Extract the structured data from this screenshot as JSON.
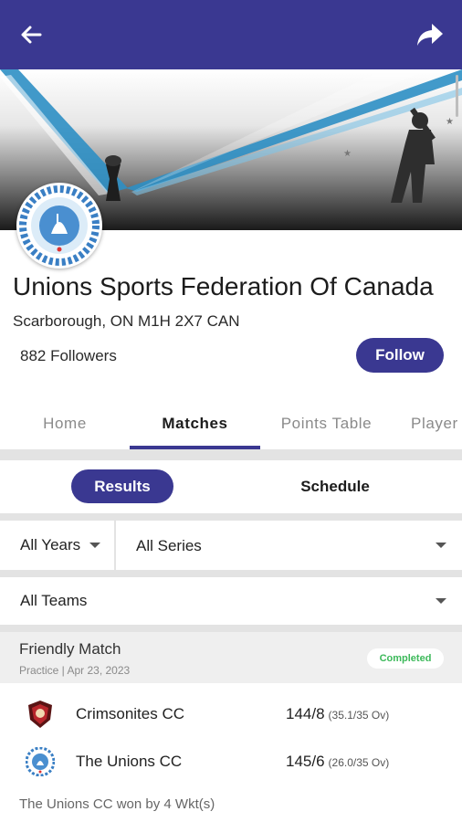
{
  "header": {
    "back_icon": "arrow-left-icon",
    "share_icon": "share-icon",
    "bar_color": "#3a3891"
  },
  "profile": {
    "name": "Unions Sports Federation Of Canada",
    "address": "Scarborough, ON M1H 2X7 CAN",
    "followers": "882 Followers",
    "follow_label": "Follow"
  },
  "tabs": [
    {
      "label": "Home",
      "active": false
    },
    {
      "label": "Matches",
      "active": true
    },
    {
      "label": "Points Table",
      "active": false
    },
    {
      "label": "Player",
      "active": false
    }
  ],
  "toggle": {
    "results_label": "Results",
    "schedule_label": "Schedule"
  },
  "filters": {
    "years": "All Years",
    "series": "All Series",
    "teams": "All Teams"
  },
  "match": {
    "title": "Friendly Match",
    "meta": "Practice | Apr 23, 2023",
    "status": "Completed",
    "status_color": "#3cb95a",
    "teams": [
      {
        "name": "Crimsonites CC",
        "score": "144/8",
        "overs": "(35.1/35 Ov)"
      },
      {
        "name": "The Unions CC",
        "score": "145/6",
        "overs": "(26.0/35 Ov)"
      }
    ],
    "result": "The Unions CC won by 4 Wkt(s)"
  }
}
